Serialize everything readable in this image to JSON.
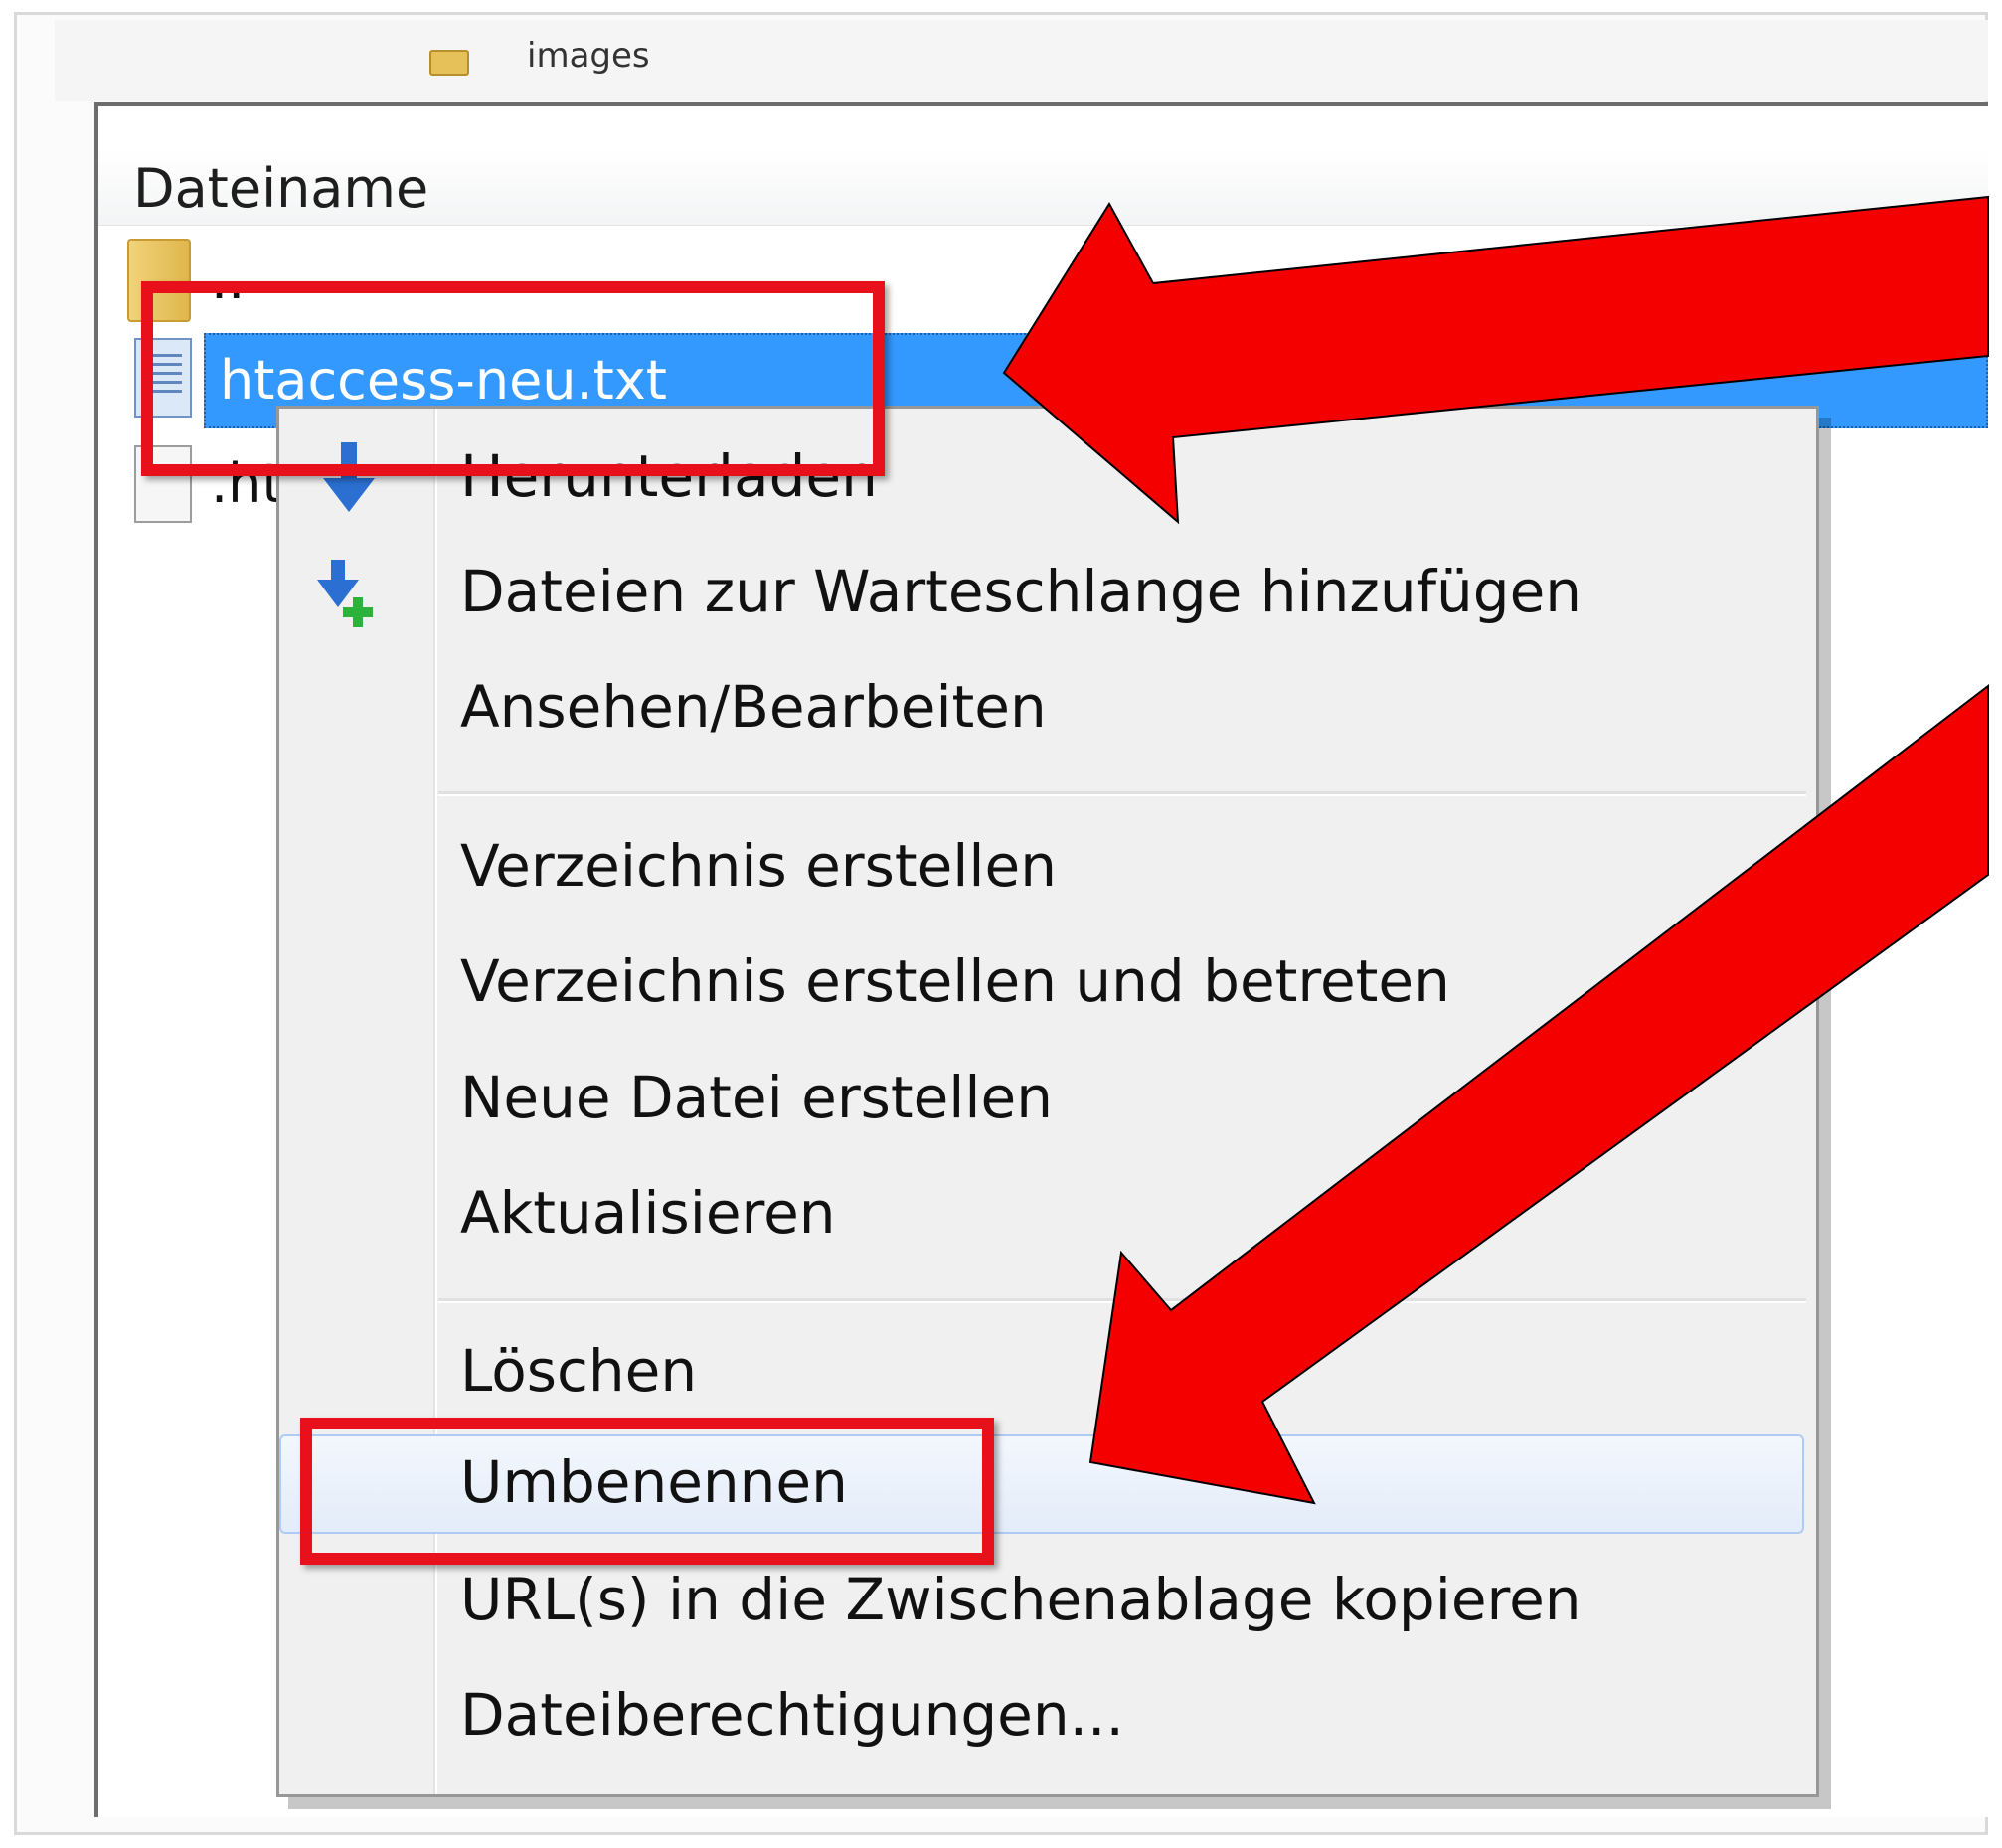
{
  "breadcrumb": {
    "folder_label": "images"
  },
  "file_list": {
    "column_header": "Dateiname",
    "files": [
      {
        "name": "..",
        "type": "folder"
      },
      {
        "name": "htaccess-neu.txt",
        "type": "text-file",
        "selected": true
      },
      {
        "name": ".htaccess",
        "type": "file"
      }
    ]
  },
  "context_menu": {
    "items": [
      {
        "label": "Herunterladen",
        "icon": "download-arrow-icon"
      },
      {
        "label": "Dateien zur Warteschlange hinzufügen",
        "icon": "add-to-queue-icon"
      },
      {
        "label": "Ansehen/Bearbeiten"
      },
      {
        "label": "Verzeichnis erstellen"
      },
      {
        "label": "Verzeichnis erstellen und betreten"
      },
      {
        "label": "Neue Datei erstellen"
      },
      {
        "label": "Aktualisieren"
      },
      {
        "label": "Löschen"
      },
      {
        "label": "Umbenennen",
        "hovered": true
      },
      {
        "label": "URL(s) in die Zwischenablage kopieren"
      },
      {
        "label": "Dateiberechtigungen..."
      }
    ]
  },
  "annotations": {
    "highlight_color": "#e8111b",
    "icons": [
      "callout-arrow-icon",
      "callout-arrow-icon"
    ]
  }
}
